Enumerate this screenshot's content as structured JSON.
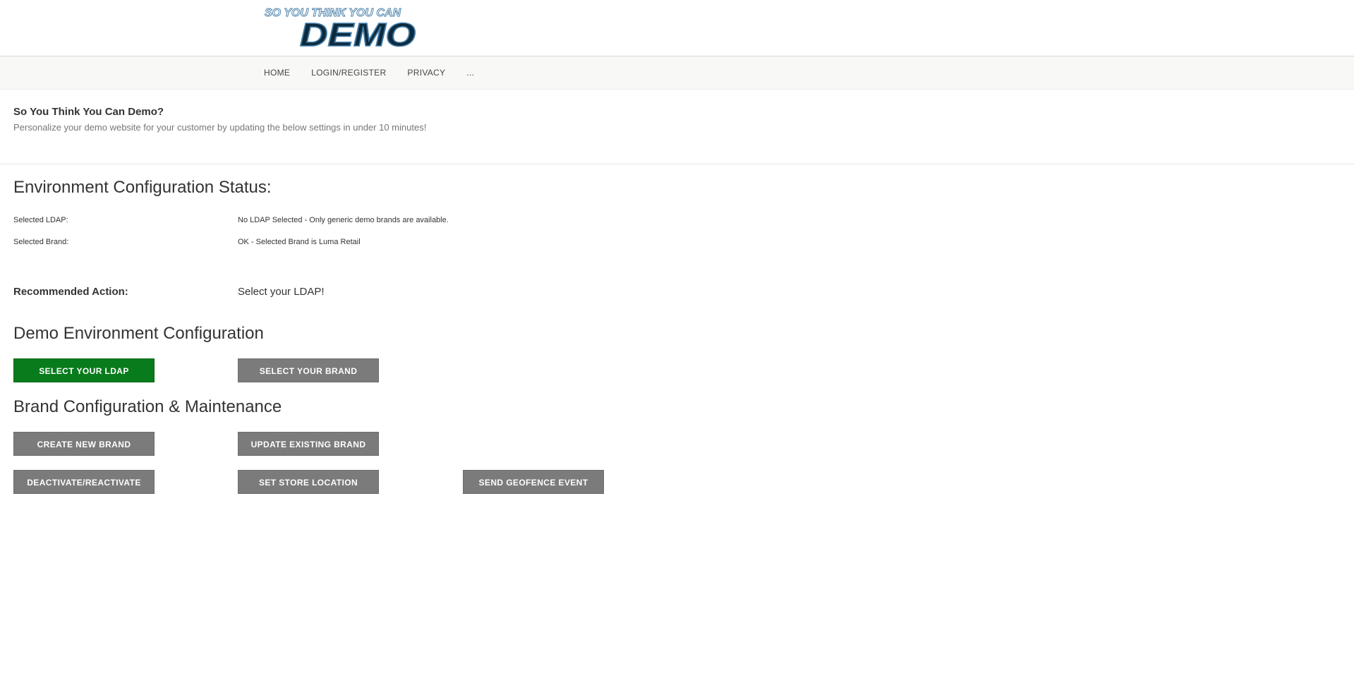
{
  "header": {
    "logo": {
      "line1": "SO YOU THINK YOU CAN",
      "line2": "DEMO",
      "icon": "demo-logo"
    }
  },
  "nav": {
    "items": [
      {
        "label": "HOME"
      },
      {
        "label": "LOGIN/REGISTER"
      },
      {
        "label": "PRIVACY"
      },
      {
        "label": "..."
      }
    ]
  },
  "hero": {
    "title": "So You Think You Can Demo?",
    "subtitle": "Personalize your demo website for your customer by updating the below settings in under 10 minutes!"
  },
  "status": {
    "heading": "Environment Configuration Status:",
    "rows": [
      {
        "label": "Selected LDAP:",
        "value": "No LDAP Selected - Only generic demo brands are available."
      },
      {
        "label": "Selected Brand:",
        "value": "OK - Selected Brand is Luma Retail"
      }
    ]
  },
  "recommended": {
    "label": "Recommended Action:",
    "value": "Select your LDAP!"
  },
  "demo_config": {
    "heading": "Demo Environment Configuration",
    "buttons": {
      "select_ldap": "SELECT YOUR LDAP",
      "select_brand": "SELECT YOUR BRAND"
    }
  },
  "brand_config": {
    "heading": "Brand Configuration & Maintenance",
    "buttons": {
      "create_brand": "CREATE NEW BRAND",
      "update_brand": "UPDATE EXISTING BRAND",
      "deactivate": "DEACTIVATE/REACTIVATE",
      "store_location": "SET STORE LOCATION",
      "geofence": "SEND GEOFENCE EVENT"
    }
  },
  "colors": {
    "primary_button": "#087b1c",
    "default_button": "#7b7b7b",
    "nav_background": "#f8f8f7",
    "logo_dark": "#0d2a3d",
    "logo_light": "#3f7aa6"
  }
}
